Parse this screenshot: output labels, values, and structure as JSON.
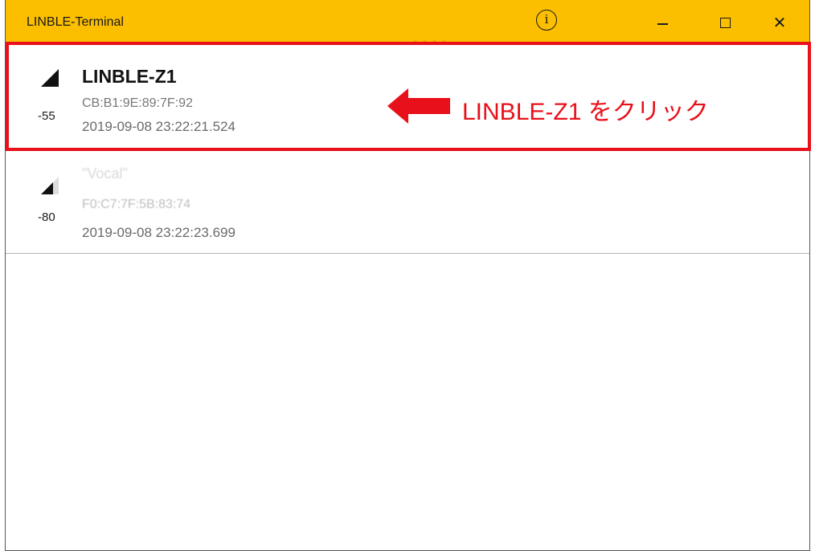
{
  "window": {
    "title": "LINBLE-Terminal",
    "info_label": "i",
    "accent_color": "#fbbf00"
  },
  "controls": {
    "minimize": "minimize-icon",
    "maximize": "maximize-icon",
    "close": "close-icon",
    "close_glyph": "✕"
  },
  "devices": [
    {
      "name": "LINBLE-Z1",
      "mac": "CB:B1:9E:89:7F:92",
      "timestamp": "2019-09-08 23:22:21.524",
      "rssi": "-55",
      "signal_level": "full"
    },
    {
      "name": "\"Vocal\"",
      "mac": "F0:C7:7F:5B:83:74",
      "timestamp": "2019-09-08 23:22:23.699",
      "rssi": "-80",
      "signal_level": "partial"
    }
  ],
  "annotation": {
    "text": "LINBLE-Z1 をクリック",
    "color": "#e8101a"
  }
}
